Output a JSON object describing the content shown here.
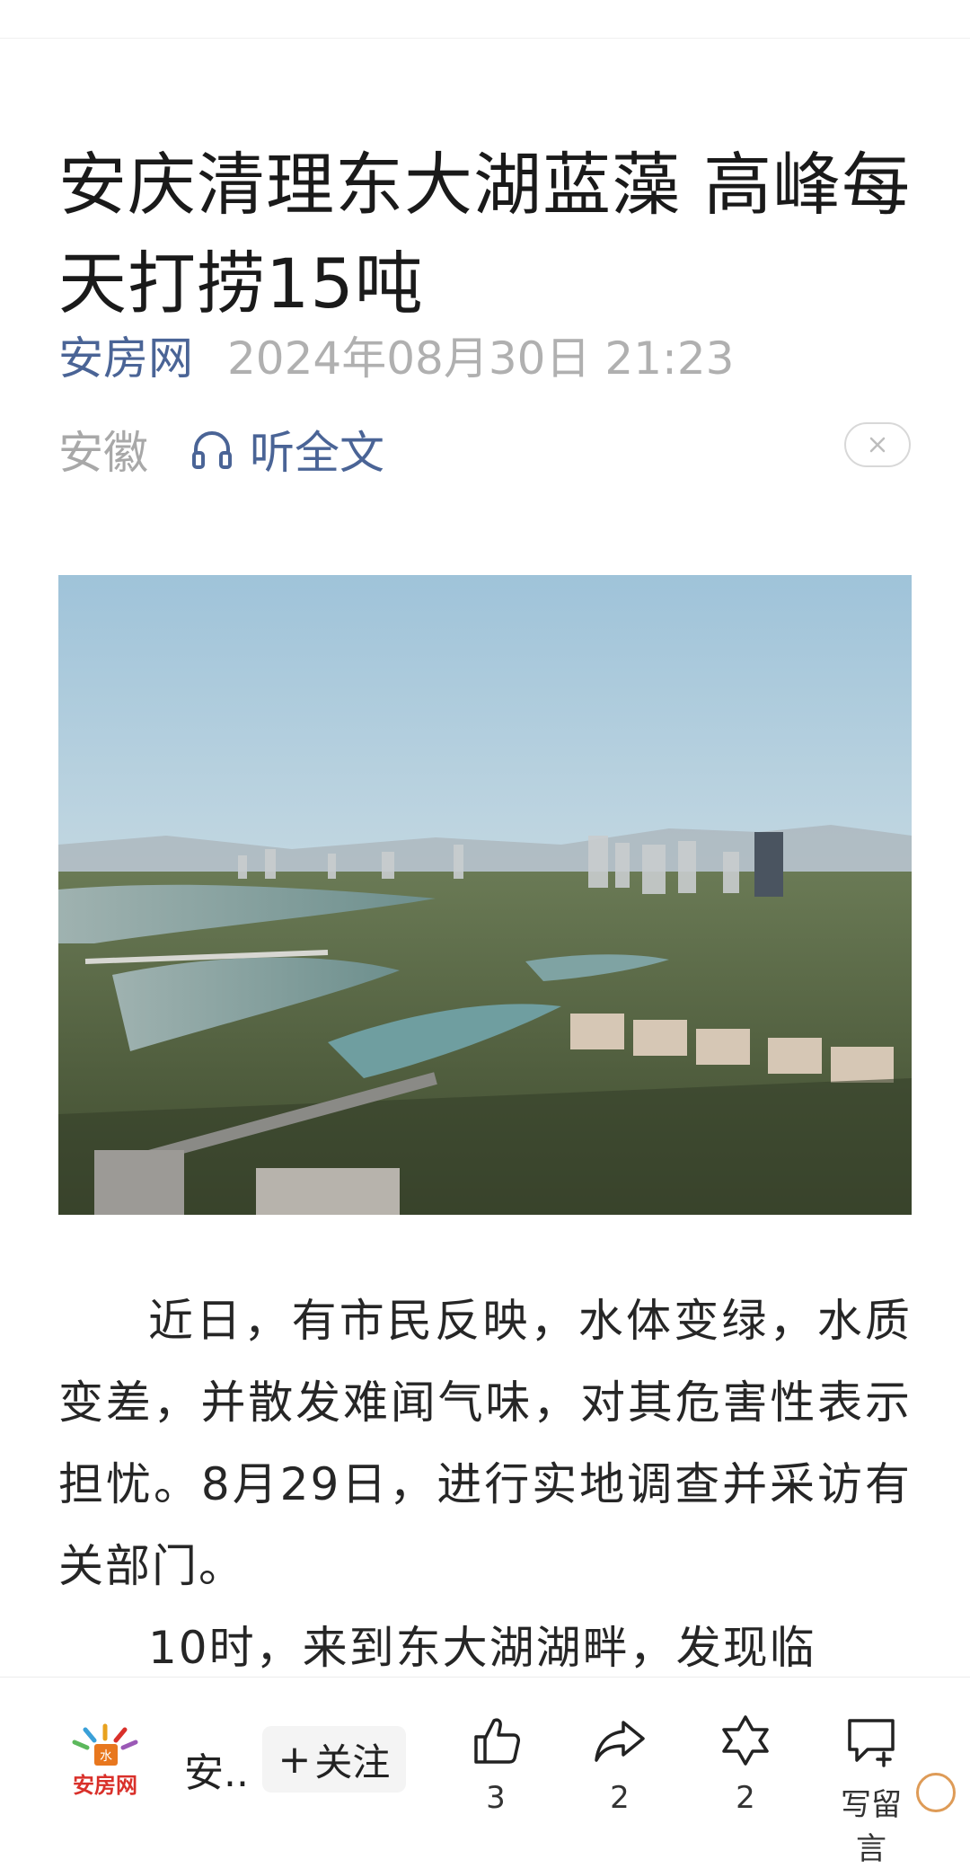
{
  "article": {
    "title": "安庆清理东大湖蓝藻 高峰每天打捞15吨",
    "source": "安房网",
    "published": "2024年08月30日 21:23",
    "region": "安徽",
    "listen_label": "听全文",
    "hero_image_alt": "East Lake aerial view",
    "paragraphs": [
      "近日，有市民反映，水体变绿，水质变差，并散发难闻气味，对其危害性表示担忧。8月29日，进行实地调查并采访有关部门。",
      "10时，来到东大湖湖畔，发现临"
    ]
  },
  "bottom_bar": {
    "brand_logo_text": "安房网",
    "author_name": "安..",
    "follow_label": "关注",
    "like_count": "3",
    "share_count": "2",
    "favorite_count": "2",
    "comment_label": "写留言"
  },
  "colors": {
    "link_blue": "#4a6496",
    "muted_gray": "#b0b0b0",
    "brand_orange": "#e8771e",
    "brand_red": "#d9302a"
  }
}
